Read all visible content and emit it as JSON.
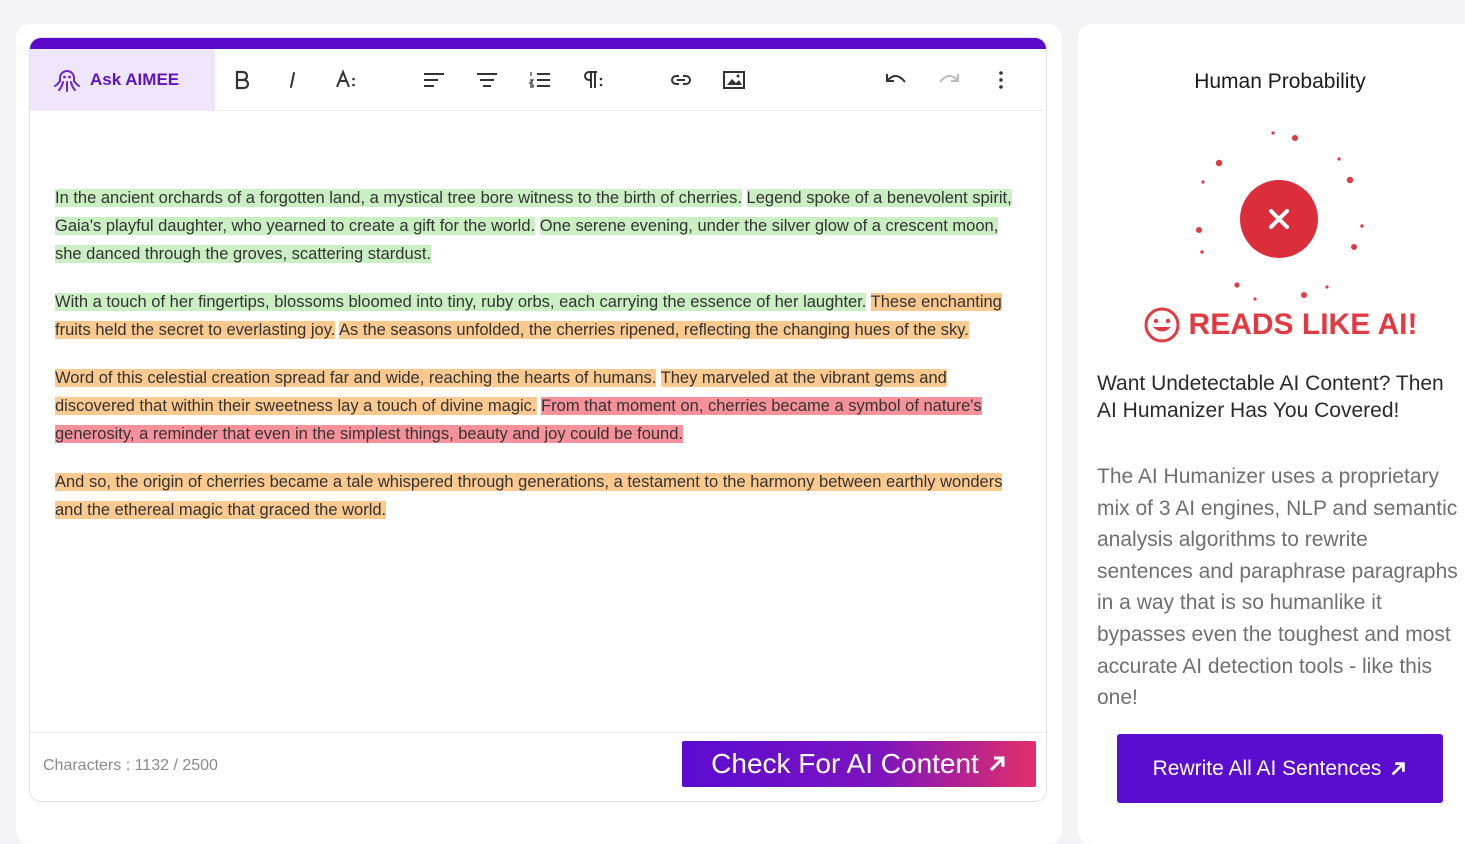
{
  "toolbar": {
    "ask_label": "Ask AIMEE"
  },
  "editor": {
    "paragraphs": [
      [
        {
          "text": "In the ancient orchards of a forgotten land, a mystical tree bore witness to the birth of cherries.",
          "level": "green"
        },
        {
          "text": " ",
          "level": "none"
        },
        {
          "text": "Legend spoke of a benevolent spirit, Gaia's playful daughter, who yearned to create a gift for the world.",
          "level": "green"
        },
        {
          "text": " ",
          "level": "none"
        },
        {
          "text": "One serene evening, under the silver glow of a crescent moon, she danced through the groves, scattering stardust.",
          "level": "green"
        }
      ],
      [
        {
          "text": "With a touch of her fingertips, blossoms bloomed into tiny, ruby orbs, each carrying the essence of her laughter.",
          "level": "green"
        },
        {
          "text": " ",
          "level": "none"
        },
        {
          "text": "These enchanting fruits held the secret to everlasting joy.",
          "level": "orange"
        },
        {
          "text": " ",
          "level": "none"
        },
        {
          "text": "As the seasons unfolded, the cherries ripened, reflecting the changing hues of the sky.",
          "level": "orange"
        }
      ],
      [
        {
          "text": "Word of this celestial creation spread far and wide, reaching the hearts of humans.",
          "level": "orange"
        },
        {
          "text": " ",
          "level": "none"
        },
        {
          "text": "They marveled at the vibrant gems and discovered that within their sweetness lay a touch of divine magic.",
          "level": "orange"
        },
        {
          "text": " ",
          "level": "none"
        },
        {
          "text": "From that moment on, cherries became a symbol of nature's generosity, a reminder that even in the simplest things, beauty and joy could be found.",
          "level": "red"
        }
      ],
      [
        {
          "text": "And so, the origin of cherries became a tale whispered through generations, a testament to the harmony between earthly wonders and the ethereal magic that graced the world.",
          "level": "orange"
        }
      ]
    ],
    "char_count_label": "Characters : 1132  / 2500",
    "check_button_label": "Check For AI Content"
  },
  "colors": {
    "accent": "#5b08c9",
    "green_highlight": "#c9efc2",
    "orange_highlight": "#fcc98f",
    "red_highlight": "#f9919a",
    "verdict_red": "#e13a43"
  },
  "result": {
    "title": "Human Probability",
    "verdict": "READS LIKE AI!",
    "verdict_icon": "smiley-face-icon",
    "status_icon": "close-icon"
  },
  "promo": {
    "title": "Want Undetectable AI Content? Then AI Humanizer Has You Covered!",
    "body": "The AI Humanizer uses a proprietary mix of 3 AI engines, NLP and semantic analysis algorithms to rewrite sentences and paraphrase paragraphs in a way that is so humanlike it bypasses even the toughest and most accurate AI detection tools - like this one!",
    "button_label": "Rewrite All AI Sentences"
  }
}
